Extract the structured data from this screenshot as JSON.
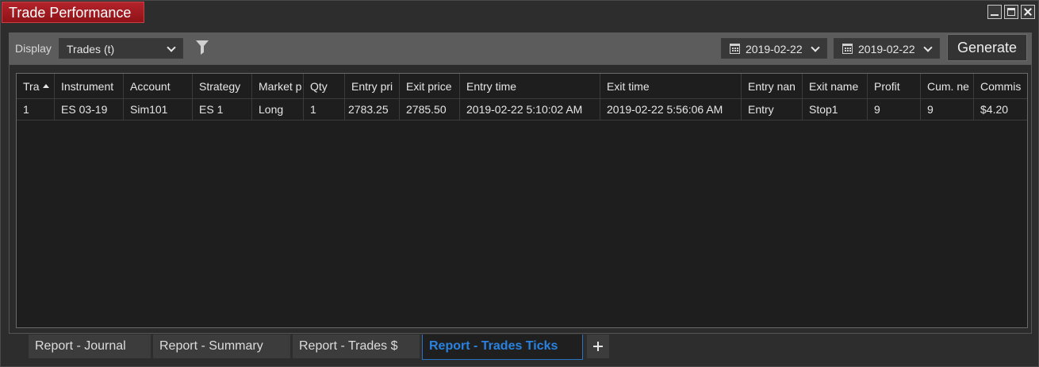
{
  "window": {
    "title": "Trade Performance"
  },
  "toolbar": {
    "display_label": "Display",
    "display_value": "Trades (t)",
    "from_date": "2019-02-22",
    "to_date": "2019-02-22",
    "generate_label": "Generate"
  },
  "table": {
    "columns": [
      "Tra",
      "Instrument",
      "Account",
      "Strategy",
      "Market p",
      "Qty",
      "Entry pri",
      "Exit price",
      "Entry time",
      "Exit time",
      "Entry nan",
      "Exit name",
      "Profit",
      "Cum. ne",
      "Commis"
    ],
    "sort_column": "Tra",
    "rows": [
      [
        "1",
        "ES 03-19",
        "Sim101",
        "ES 1",
        "Long",
        "1",
        "2783.25",
        "2785.50",
        "2019-02-22 5:10:02 AM",
        "2019-02-22 5:56:06 AM",
        "Entry",
        "Stop1",
        "9",
        "9",
        "$4.20"
      ]
    ]
  },
  "tabs": [
    {
      "label": "Report - Journal",
      "active": false
    },
    {
      "label": "Report - Summary",
      "active": false
    },
    {
      "label": "Report - Trades $",
      "active": false
    },
    {
      "label": "Report - Trades Ticks",
      "active": true
    }
  ],
  "colors": {
    "title_bg": "#a01c22",
    "active_tab_text": "#2a82e0",
    "grid_bg": "#1e1e1e",
    "toolbar_bg": "#5c5c5c"
  },
  "icons": {
    "filter": "filter-icon",
    "calendar": "calendar-icon",
    "add_tab": "plus-icon"
  }
}
